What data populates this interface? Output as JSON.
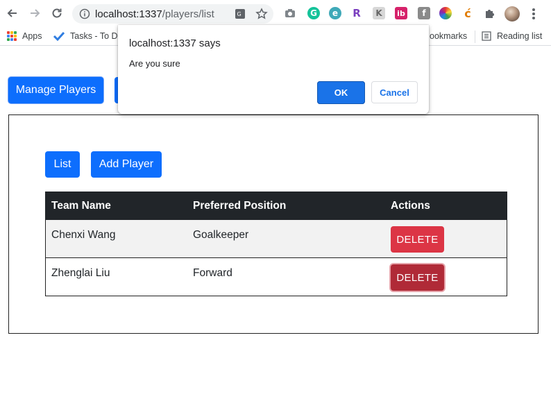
{
  "browser": {
    "url_host": "localhost:1337",
    "url_path": "/players/list",
    "bookmarks": {
      "apps_label": "Apps",
      "tasks_label": "Tasks - To Do",
      "other_label": "ookmarks",
      "reading_list_label": "Reading list"
    },
    "extensions": [
      "camera-icon",
      "grammarly-icon",
      "edge-icon",
      "r-icon",
      "k-icon",
      "ib-icon",
      "f-icon",
      "color-wheel-icon",
      "c-icon",
      "puzzle-icon"
    ]
  },
  "page": {
    "manage_players_label": "Manage Players",
    "list_label": "List",
    "add_player_label": "Add Player",
    "table": {
      "headers": [
        "Team Name",
        "Preferred Position",
        "Actions"
      ],
      "rows": [
        {
          "name": "Chenxi Wang",
          "position": "Goalkeeper",
          "action": "DELETE"
        },
        {
          "name": "Zhenglai Liu",
          "position": "Forward",
          "action": "DELETE"
        }
      ]
    }
  },
  "dialog": {
    "title": "localhost:1337 says",
    "message": "Are you sure",
    "ok_label": "OK",
    "cancel_label": "Cancel"
  },
  "colors": {
    "primary": "#0d6efd",
    "danger": "#dc3545",
    "danger_hover": "#b02a37",
    "table_header": "#212529",
    "dialog_ok": "#1a73e8"
  }
}
